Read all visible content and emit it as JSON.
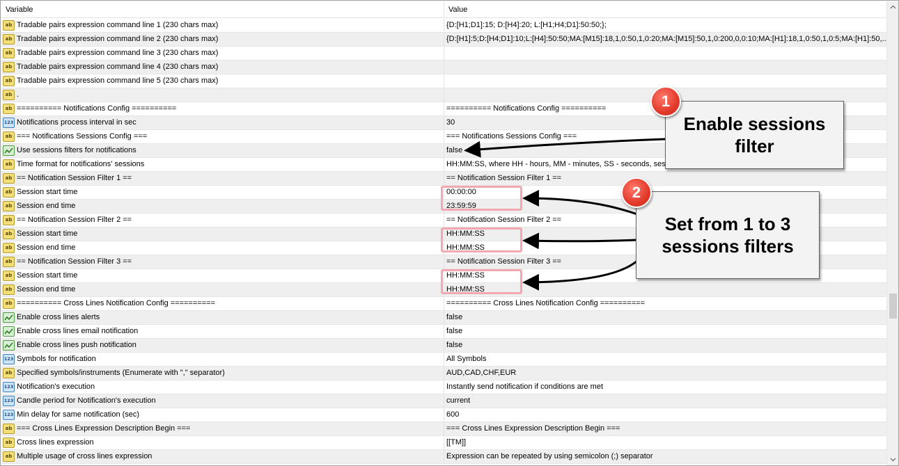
{
  "header": {
    "variable": "Variable",
    "value": "Value"
  },
  "rows": [
    {
      "type": "ab",
      "label": "Tradable pairs expression command line 1 (230 chars max)",
      "value": "{D:[H1;D1]:15; D:[H4]:20; L:[H1;H4;D1]:50:50;};"
    },
    {
      "type": "ab",
      "label": "Tradable pairs expression command line 2 (230 chars max)",
      "value": "{D:[H1]:5;D:[H4;D1]:10;L:[H4]:50:50;MA:[M15]:18,1,0:50,1,0:20;MA:[M15]:50,1,0:200,0,0:10;MA:[H1]:18,1,0:50,1,0:5;MA:[H1]:50,..."
    },
    {
      "type": "ab",
      "label": "Tradable pairs expression command line 3 (230 chars max)",
      "value": ""
    },
    {
      "type": "ab",
      "label": "Tradable pairs expression command line 4 (230 chars max)",
      "value": ""
    },
    {
      "type": "ab",
      "label": "Tradable pairs expression command line 5 (230 chars max)",
      "value": ""
    },
    {
      "type": "ab",
      "label": ".",
      "value": ""
    },
    {
      "type": "ab",
      "label": "========== Notifications Config ==========",
      "value": "========== Notifications Config =========="
    },
    {
      "type": "num",
      "label": "Notifications process interval in sec",
      "value": "30"
    },
    {
      "type": "ab",
      "label": "=== Notifications Sessions Config ===",
      "value": "=== Notifications Sessions Config ==="
    },
    {
      "type": "bool",
      "label": "Use sessions filters for notifications",
      "value": "false"
    },
    {
      "type": "ab",
      "label": "Time format for notifications' sessions",
      "value": "HH:MM:SS, where HH - hours, MM - minutes, SS - seconds, sessio"
    },
    {
      "type": "ab",
      "label": "== Notification Session Filter 1 ==",
      "value": "== Notification Session Filter 1 =="
    },
    {
      "type": "ab",
      "label": "Session start time",
      "value": "00:00:00"
    },
    {
      "type": "ab",
      "label": "Session end time",
      "value": "23:59:59"
    },
    {
      "type": "ab",
      "label": "== Notification Session Filter 2 ==",
      "value": "== Notification Session Filter 2 =="
    },
    {
      "type": "ab",
      "label": "Session start time",
      "value": "HH:MM:SS"
    },
    {
      "type": "ab",
      "label": "Session end time",
      "value": "HH:MM:SS"
    },
    {
      "type": "ab",
      "label": "== Notification Session Filter 3 ==",
      "value": "== Notification Session Filter 3 =="
    },
    {
      "type": "ab",
      "label": "Session start time",
      "value": "HH:MM:SS"
    },
    {
      "type": "ab",
      "label": "Session end time",
      "value": "HH:MM:SS"
    },
    {
      "type": "ab",
      "label": "========== Cross Lines Notification Config ==========",
      "value": "========== Cross Lines Notification Config =========="
    },
    {
      "type": "bool",
      "label": "Enable cross lines alerts",
      "value": "false"
    },
    {
      "type": "bool",
      "label": "Enable cross lines email notification",
      "value": "false"
    },
    {
      "type": "bool",
      "label": "Enable cross lines push notification",
      "value": "false"
    },
    {
      "type": "num",
      "label": "Symbols for notification",
      "value": "All Symbols"
    },
    {
      "type": "ab",
      "label": "Specified symbols/instruments (Enumerate with \",\" separator)",
      "value": "AUD,CAD,CHF,EUR"
    },
    {
      "type": "num",
      "label": "Notification's execution",
      "value": "Instantly send notification if conditions are met"
    },
    {
      "type": "num",
      "label": "Candle period for Notification's execution",
      "value": "current"
    },
    {
      "type": "num",
      "label": "Min delay for same notification (sec)",
      "value": "600"
    },
    {
      "type": "ab",
      "label": "=== Cross Lines Expression Description Begin ===",
      "value": "=== Cross Lines Expression Description Begin ==="
    },
    {
      "type": "ab",
      "label": "Cross lines expression",
      "value": "[[TM]]"
    },
    {
      "type": "ab",
      "label": "Multiple usage of cross lines expression",
      "value": "Expression can be repeated by using semicolon (;) separator"
    }
  ],
  "icons": {
    "ab": "ab",
    "num": "123"
  },
  "annotations": {
    "callout1": {
      "badge": "1",
      "line1": "Enable sessions",
      "line2": "filter"
    },
    "callout2": {
      "badge": "2",
      "line1": "Set from 1 to 3",
      "line2": "sessions filters"
    }
  },
  "colors": {
    "badge": "#e2392a",
    "highlight": "#f2a8b0",
    "callout_bg": "#f3f3f3"
  }
}
